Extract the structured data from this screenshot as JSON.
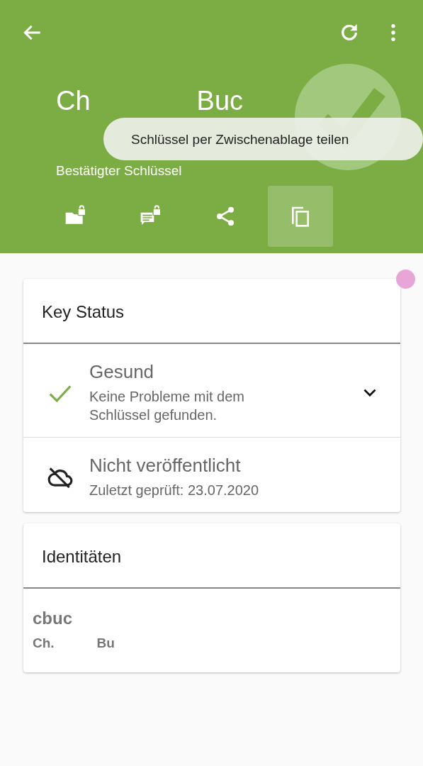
{
  "header": {
    "name_parts": [
      "Ch",
      "Buc"
    ],
    "subtitle": "Bestätigter Schlüssel",
    "verified": true,
    "actions": [
      {
        "kind": "file",
        "selected": false
      },
      {
        "kind": "message",
        "selected": false
      },
      {
        "kind": "share",
        "selected": false
      },
      {
        "kind": "copy",
        "selected": true
      }
    ]
  },
  "toast": "Schlüssel per Zwischenablage teilen",
  "key_status": {
    "title": "Key Status",
    "rows": [
      {
        "kind": "healthy",
        "title": "Gesund",
        "detail": "Keine Probleme mit dem Schlüssel gefunden.",
        "expandable": true
      },
      {
        "kind": "unpublished",
        "title": "Nicht veröffentlicht",
        "detail": "Zuletzt geprüft: 23.07.2020",
        "expandable": false
      }
    ]
  },
  "identities": {
    "title": "Identitäten",
    "items": [
      {
        "email_parts": [
          "cbuc"
        ],
        "name_parts": [
          "Ch.",
          "Bu"
        ]
      }
    ]
  }
}
